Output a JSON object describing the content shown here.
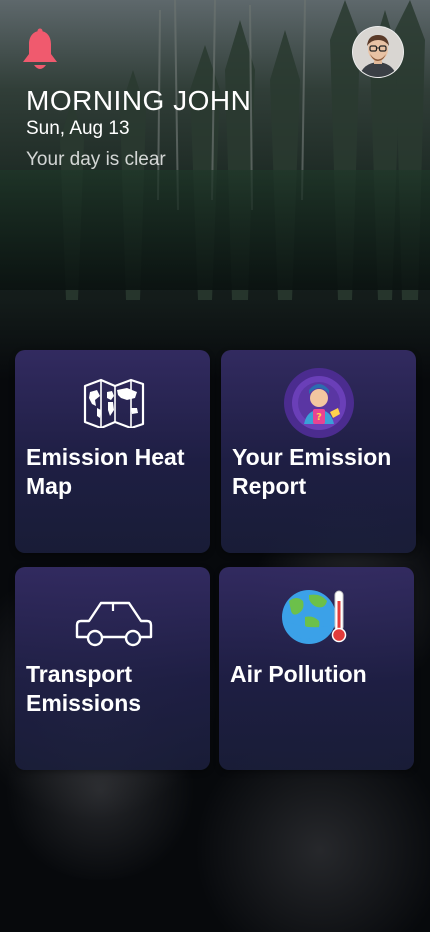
{
  "header": {
    "greeting": "MORNING JOHN",
    "date": "Sun, Aug 13",
    "status": "Your day is clear",
    "bell_icon": "bell-icon",
    "avatar_icon": "user-avatar"
  },
  "cards": [
    {
      "label": "Emission Heat Map",
      "icon": "world-map-icon"
    },
    {
      "label": "Your Emission Report",
      "icon": "emission-report-icon"
    },
    {
      "label": "Transport Emissions",
      "icon": "car-icon"
    },
    {
      "label": "Air Pollution",
      "icon": "melting-earth-thermometer-icon"
    }
  ],
  "colors": {
    "bell": "#f05a6e",
    "card_top": "#342c64",
    "card_bottom": "#1a1e3a"
  }
}
